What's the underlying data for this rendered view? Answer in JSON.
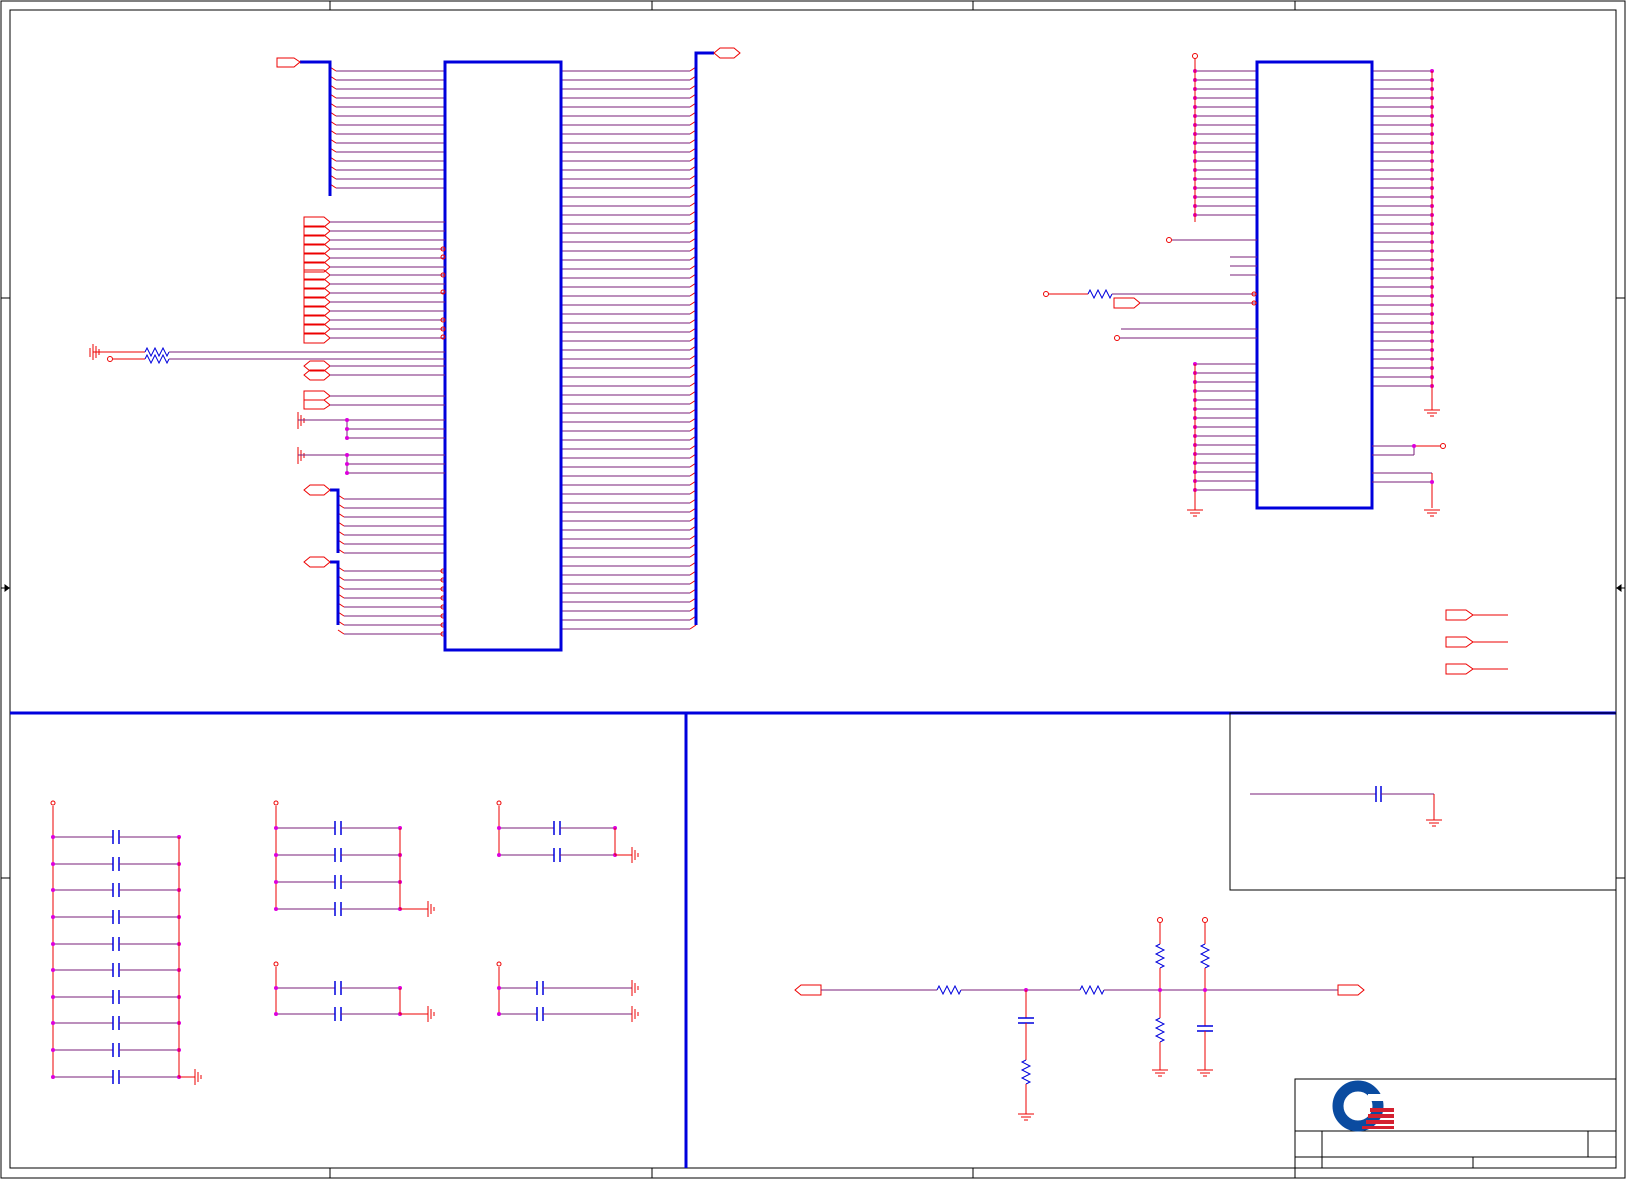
{
  "palette": {
    "background": "#ffffff",
    "frame": "#000000",
    "bus": "#0000dd",
    "wire": "#ee0000",
    "net": "#7a1f7a",
    "junction": "#dd00dd",
    "capacitor": "#0000dd",
    "logo_blue": "#0a4ba0",
    "logo_red": "#d42030"
  },
  "icons": {
    "logo": "company-logo-icon",
    "ground": "ground-symbol-icon",
    "power": "power-port-icon",
    "resistor": "resistor-icon",
    "capacitor": "capacitor-icon",
    "port": "offpage-port-icon"
  },
  "title_block": {
    "logo_letters": ""
  }
}
